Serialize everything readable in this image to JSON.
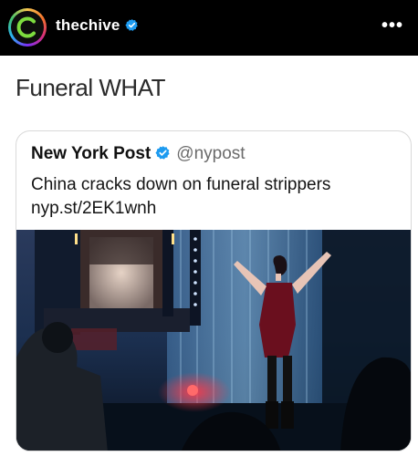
{
  "header": {
    "username": "thechive",
    "avatar_icon": "chive-logo-icon",
    "verified_icon": "verified-badge-icon",
    "more_label": "•••"
  },
  "post": {
    "caption": "Funeral WHAT"
  },
  "tweet": {
    "display_name": "New York Post",
    "handle": "@nypost",
    "text": "China cracks down on funeral strippers",
    "link": "nyp.st/2EK1wnh",
    "image_description": "photo-funeral-stage"
  },
  "colors": {
    "topbar_bg": "#000000",
    "verified_blue": "#1d9bf0",
    "handle_gray": "#6b6b6b"
  }
}
